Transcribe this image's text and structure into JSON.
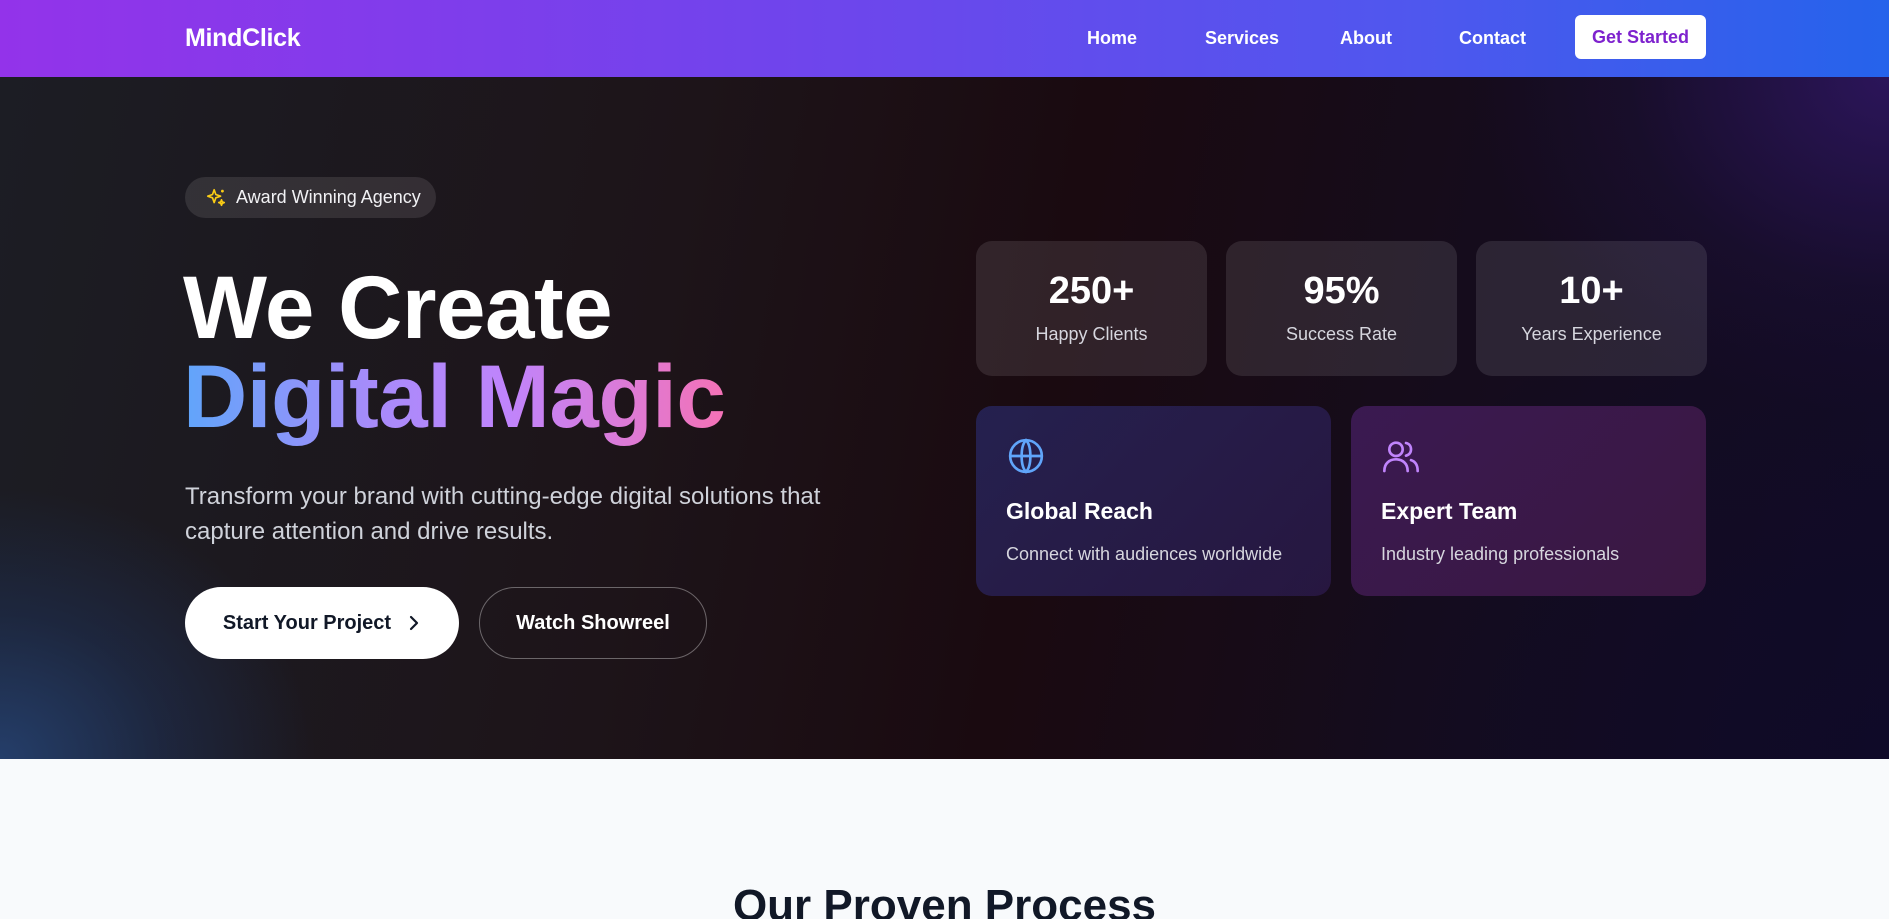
{
  "nav": {
    "logo": "MindClick",
    "links": [
      "Home",
      "Services",
      "About",
      "Contact"
    ],
    "cta": "Get Started"
  },
  "hero": {
    "badge": "Award Winning Agency",
    "title_line1": "We Create",
    "title_line2": "Digital Magic",
    "subtitle": "Transform your brand with cutting-edge digital solutions that capture attention and drive results.",
    "primary_button": "Start Your Project",
    "secondary_button": "Watch Showreel",
    "stats": [
      {
        "value": "250+",
        "label": "Happy Clients"
      },
      {
        "value": "95%",
        "label": "Success Rate"
      },
      {
        "value": "10+",
        "label": "Years Experience"
      }
    ],
    "features": [
      {
        "title": "Global Reach",
        "desc": "Connect with audiences worldwide",
        "icon": "globe-icon"
      },
      {
        "title": "Expert Team",
        "desc": "Industry leading professionals",
        "icon": "users-icon"
      }
    ]
  },
  "process": {
    "title": "Our Proven Process"
  },
  "colors": {
    "accent_purple": "#9333ea",
    "accent_blue": "#2563eb",
    "badge_icon": "#facc15",
    "globe_icon": "#60a5fa",
    "users_icon": "#c084fc"
  }
}
